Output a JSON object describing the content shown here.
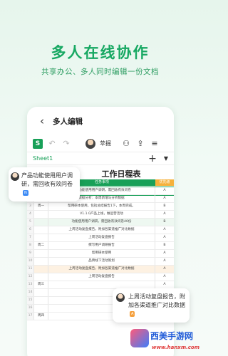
{
  "hero": {
    "title": "多人在线协作",
    "subtitle": "共享办公、多人同时编辑一份文档"
  },
  "app": {
    "title": "多人编辑",
    "user_name": "苹掘",
    "sheet_tab": "Sheet1",
    "logo_letter": "S"
  },
  "sheet": {
    "title": "工作日程表",
    "col_task": "任务事项",
    "col_priority": "优先级",
    "accent_green": "#18a058",
    "header_orange": "#f5b13b",
    "rows": [
      {
        "n": "1",
        "day": "",
        "text": "产品功能使用用户调研，需回收有效问卷",
        "p": "A"
      },
      {
        "n": "2",
        "day": "",
        "text": "数据分析：本周新增与分析数据",
        "p": "A"
      },
      {
        "n": "3",
        "day": "周一",
        "text": "帮用研本使用，包括总结报告1下，本周完成。",
        "p": "B"
      },
      {
        "n": "4",
        "day": "",
        "text": "V1.1.0产品上线，做运营活动",
        "p": "A"
      },
      {
        "n": "5",
        "day": "",
        "text": "功能使用用户调研，需回收有效问卷40份",
        "p": "B"
      },
      {
        "n": "6",
        "day": "",
        "text": "上周活动复盘报告，附加各渠道推广对比数据",
        "p": "A"
      },
      {
        "n": "7",
        "day": "",
        "text": "上周活动复盘报告",
        "p": "A"
      },
      {
        "n": "8",
        "day": "周二",
        "text": "撰写用户调研报告",
        "p": "B"
      },
      {
        "n": "9",
        "day": "",
        "text": "帮用研本使用",
        "p": "A"
      },
      {
        "n": "10",
        "day": "",
        "text": "品牌线下活动策划",
        "p": "A"
      },
      {
        "n": "11",
        "day": "",
        "text": "上周活动复盘报告，附加各渠道推广对比数据",
        "p": "A"
      },
      {
        "n": "12",
        "day": "",
        "text": "上周活动复盘报告",
        "p": "A"
      },
      {
        "n": "13",
        "day": "周三",
        "text": "",
        "p": "A"
      },
      {
        "n": "14",
        "day": "",
        "text": "",
        "p": "A"
      },
      {
        "n": "15",
        "day": "",
        "text": "",
        "p": "A"
      },
      {
        "n": "16",
        "day": "",
        "text": "",
        "p": "A"
      },
      {
        "n": "17",
        "day": "周四",
        "text": "",
        "p": "A"
      }
    ]
  },
  "bubbles": {
    "b1": {
      "text": "产品功能使用用户调研，需回收有效问卷",
      "tag": "N"
    },
    "b2": {
      "text": "上周活动复盘报告，附加各渠道推广对比数据",
      "tag": "A"
    }
  },
  "watermark": {
    "title": "西美手游网",
    "url": "www.hanxm.com"
  }
}
